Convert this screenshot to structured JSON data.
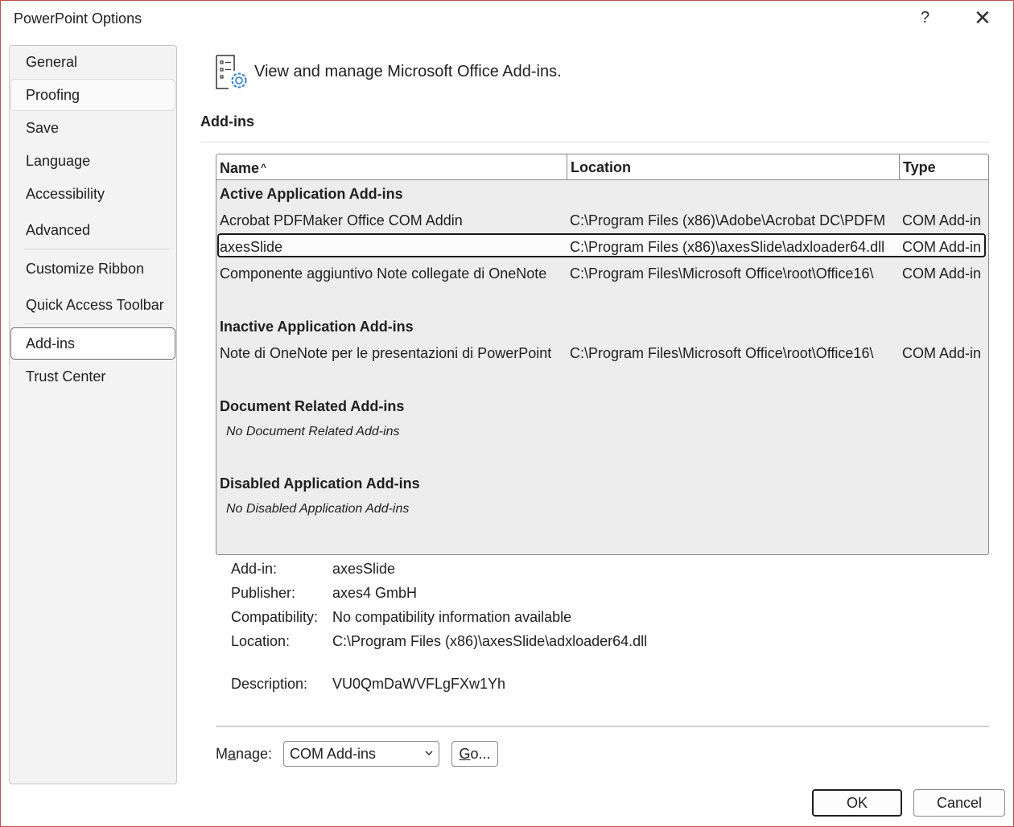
{
  "window": {
    "title": "PowerPoint Options",
    "help": "?",
    "close": "✕"
  },
  "sidebar": {
    "items": [
      {
        "label": "General"
      },
      {
        "label": "Proofing"
      },
      {
        "label": "Save"
      },
      {
        "label": "Language"
      },
      {
        "label": "Accessibility"
      },
      {
        "label": "Advanced"
      },
      {
        "label": "Customize Ribbon"
      },
      {
        "label": "Quick Access Toolbar"
      },
      {
        "label": "Add-ins"
      },
      {
        "label": "Trust Center"
      }
    ],
    "selected": "Add-ins",
    "hovered": "Proofing"
  },
  "header": {
    "text": "View and manage Microsoft Office Add-ins.",
    "icon": "addins-settings-icon"
  },
  "section": {
    "title": "Add-ins"
  },
  "grid": {
    "columns": {
      "name": "Name",
      "location": "Location",
      "type": "Type"
    },
    "sort_indicator": "^",
    "groups": {
      "active": {
        "title": "Active Application Add-ins",
        "rows": [
          {
            "name": "Acrobat PDFMaker Office COM Addin",
            "location": "C:\\Program Files (x86)\\Adobe\\Acrobat DC\\PDFM",
            "type": "COM Add-in"
          },
          {
            "name": "axesSlide",
            "location": "C:\\Program Files (x86)\\axesSlide\\adxloader64.dll",
            "type": "COM Add-in"
          },
          {
            "name": "Componente aggiuntivo Note collegate di OneNote",
            "location": "C:\\Program Files\\Microsoft Office\\root\\Office16\\",
            "type": "COM Add-in"
          }
        ]
      },
      "inactive": {
        "title": "Inactive Application Add-ins",
        "rows": [
          {
            "name": "Note di OneNote per le presentazioni di PowerPoint",
            "location": "C:\\Program Files\\Microsoft Office\\root\\Office16\\",
            "type": "COM Add-in"
          }
        ]
      },
      "document": {
        "title": "Document Related Add-ins",
        "empty": "No Document Related Add-ins"
      },
      "disabled": {
        "title": "Disabled Application Add-ins",
        "empty": "No Disabled Application Add-ins"
      }
    },
    "selected_row": "axesSlide"
  },
  "details": {
    "addin_label": "Add-in:",
    "addin_value": "axesSlide",
    "publisher_label": "Publisher:",
    "publisher_value": "axes4 GmbH",
    "compat_label": "Compatibility:",
    "compat_value": "No compatibility information available",
    "location_label": "Location:",
    "location_value": "C:\\Program Files (x86)\\axesSlide\\adxloader64.dll",
    "desc_label": "Description:",
    "desc_value": "VU0QmDaWVFLgFXw1Yh"
  },
  "manage": {
    "label_pre": "M",
    "label_key": "a",
    "label_post": "nage:",
    "selected": "COM Add-ins",
    "go_pre": "",
    "go_key": "G",
    "go_post": "o..."
  },
  "buttons": {
    "ok": "OK",
    "cancel": "Cancel"
  },
  "colors": {
    "window_border": "#c0504d",
    "grid_bg": "#ededed",
    "sidebar_bg": "#f3f3f3"
  }
}
